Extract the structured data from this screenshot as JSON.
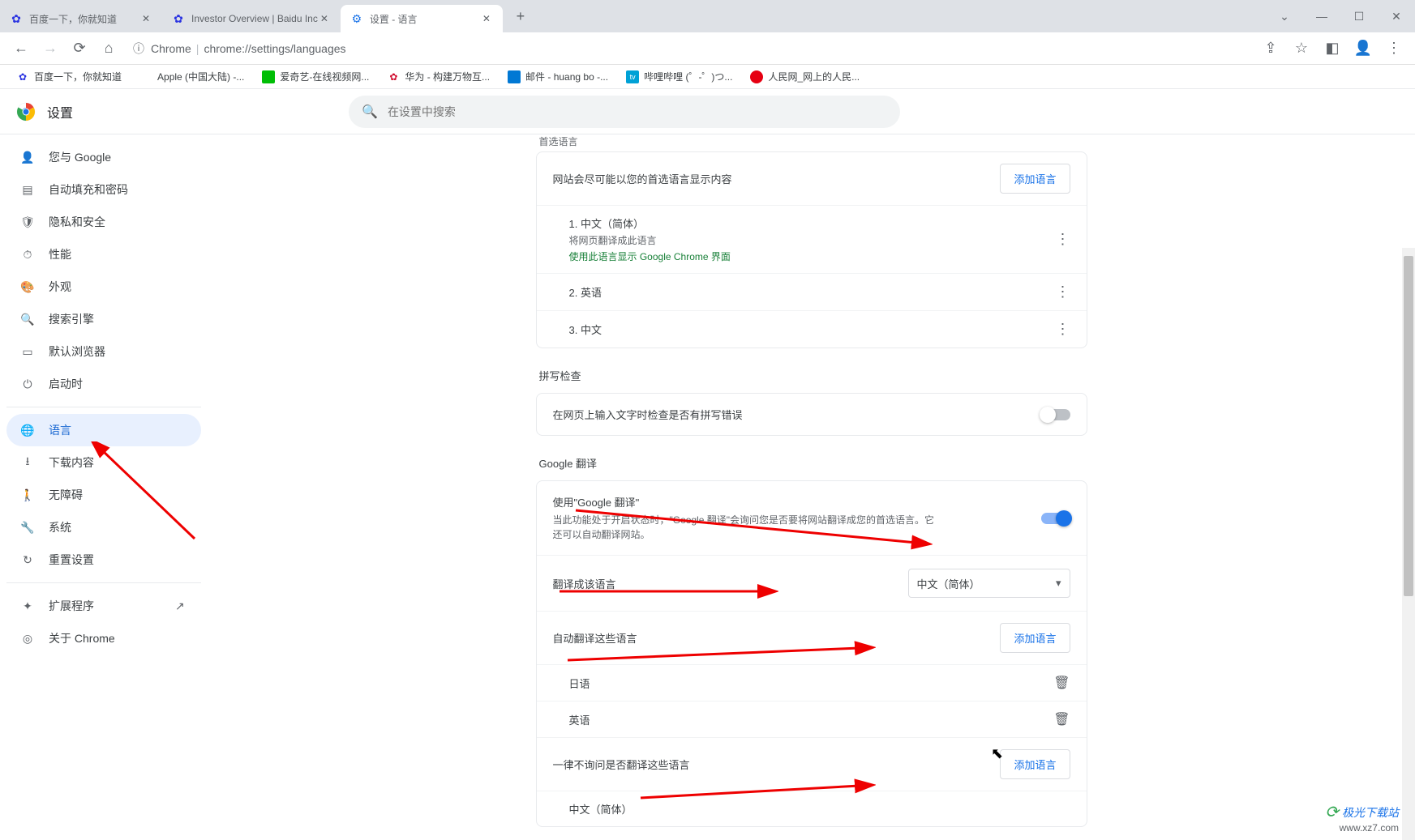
{
  "browser_tabs": [
    {
      "title": "百度一下，你就知道",
      "favicon_color": "#2932e1",
      "active": false
    },
    {
      "title": "Investor Overview | Baidu Inc",
      "favicon_color": "#2932e1",
      "active": false
    },
    {
      "title": "设置 - 语言",
      "favicon_color": "#1a73e8",
      "active": true
    }
  ],
  "url": {
    "scheme": "Chrome",
    "path": "chrome://settings/languages"
  },
  "bookmarks": [
    {
      "label": "百度一下，你就知道",
      "color": "#2932e1"
    },
    {
      "label": "Apple (中国大陆) -...",
      "color": "#000"
    },
    {
      "label": "爱奇艺-在线视频网...",
      "color": "#00be06"
    },
    {
      "label": "华为 - 构建万物互...",
      "color": "#cf0a2c"
    },
    {
      "label": "邮件 - huang bo -...",
      "color": "#0078d4"
    },
    {
      "label": "哔哩哔哩 (゜-゜)つ...",
      "color": "#00a1d6"
    },
    {
      "label": "人民网_网上的人民...",
      "color": "#e60012"
    }
  ],
  "app_title": "设置",
  "search_placeholder": "在设置中搜索",
  "sidebar": {
    "items": [
      {
        "label": "您与 Google",
        "icon": "person"
      },
      {
        "label": "自动填充和密码",
        "icon": "autofill"
      },
      {
        "label": "隐私和安全",
        "icon": "shield"
      },
      {
        "label": "性能",
        "icon": "speed"
      },
      {
        "label": "外观",
        "icon": "palette"
      },
      {
        "label": "搜索引擎",
        "icon": "search"
      },
      {
        "label": "默认浏览器",
        "icon": "browser"
      },
      {
        "label": "启动时",
        "icon": "power"
      }
    ],
    "items2": [
      {
        "label": "语言",
        "icon": "globe",
        "active": true
      },
      {
        "label": "下载内容",
        "icon": "download"
      },
      {
        "label": "无障碍",
        "icon": "accessibility"
      },
      {
        "label": "系统",
        "icon": "wrench"
      },
      {
        "label": "重置设置",
        "icon": "reset"
      }
    ],
    "items3": [
      {
        "label": "扩展程序",
        "icon": "extension",
        "ext": true
      },
      {
        "label": "关于 Chrome",
        "icon": "chrome"
      }
    ]
  },
  "content": {
    "partial_title": "首选语言",
    "pref_lang": {
      "desc": "网站会尽可能以您的首选语言显示内容",
      "add_btn": "添加语言",
      "items": [
        {
          "idx": "1.",
          "name": "中文（简体）",
          "sub": "将网页翻译成此语言",
          "note": "使用此语言显示 Google Chrome 界面"
        },
        {
          "idx": "2.",
          "name": "英语"
        },
        {
          "idx": "3.",
          "name": "中文"
        }
      ]
    },
    "spellcheck": {
      "title": "拼写检查",
      "row": "在网页上输入文字时检查是否有拼写错误",
      "on": false
    },
    "translate": {
      "title": "Google 翻译",
      "use_title": "使用\"Google 翻译\"",
      "use_desc": "当此功能处于开启状态时，\"Google 翻译\"会询问您是否要将网站翻译成您的首选语言。它还可以自动翻译网站。",
      "target_label": "翻译成该语言",
      "target_value": "中文（简体）",
      "auto_label": "自动翻译这些语言",
      "auto_items": [
        "日语",
        "英语"
      ],
      "never_label": "一律不询问是否翻译这些语言",
      "never_items": [
        "中文（简体）"
      ],
      "add_btn": "添加语言"
    }
  },
  "watermark": {
    "title": "极光下载站",
    "url": "www.xz7.com"
  }
}
